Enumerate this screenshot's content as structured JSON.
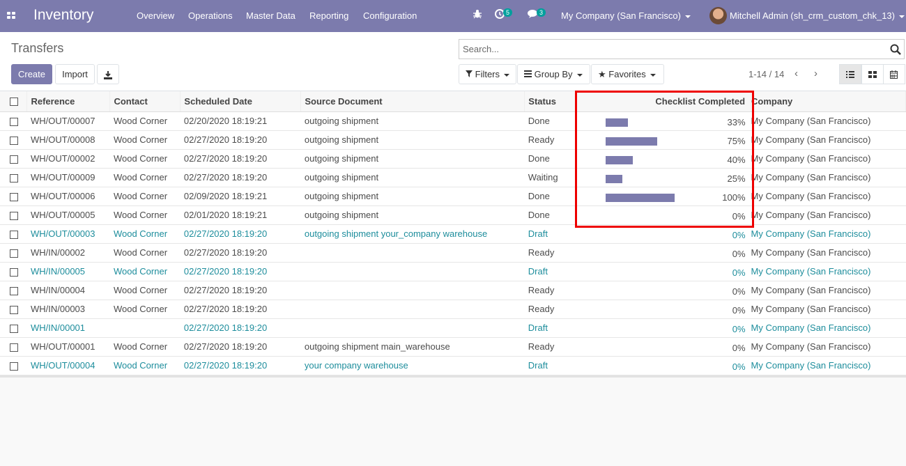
{
  "navbar": {
    "brand": "Inventory",
    "menus": [
      "Overview",
      "Operations",
      "Master Data",
      "Reporting",
      "Configuration"
    ],
    "activity_count": "5",
    "message_count": "3",
    "company": "My Company (San Francisco)",
    "user": "Mitchell Admin (sh_crm_custom_chk_13)"
  },
  "control": {
    "breadcrumb": "Transfers",
    "create_label": "Create",
    "import_label": "Import",
    "search_placeholder": "Search...",
    "filters_label": "Filters",
    "groupby_label": "Group By",
    "favorites_label": "Favorites",
    "pager": "1-14 / 14"
  },
  "table": {
    "headers": [
      "Reference",
      "Contact",
      "Scheduled Date",
      "Source Document",
      "Status",
      "Checklist Completed",
      "Company"
    ],
    "rows": [
      {
        "ref": "WH/OUT/00007",
        "contact": "Wood Corner",
        "date": "02/20/2020 18:19:21",
        "source": "outgoing shipment",
        "status": "Done",
        "progress": 33,
        "pct": "33%",
        "company": "My Company (San Francisco)",
        "draft": false
      },
      {
        "ref": "WH/OUT/00008",
        "contact": "Wood Corner",
        "date": "02/27/2020 18:19:20",
        "source": "outgoing shipment",
        "status": "Ready",
        "progress": 75,
        "pct": "75%",
        "company": "My Company (San Francisco)",
        "draft": false
      },
      {
        "ref": "WH/OUT/00002",
        "contact": "Wood Corner",
        "date": "02/27/2020 18:19:20",
        "source": "outgoing shipment",
        "status": "Done",
        "progress": 40,
        "pct": "40%",
        "company": "My Company (San Francisco)",
        "draft": false
      },
      {
        "ref": "WH/OUT/00009",
        "contact": "Wood Corner",
        "date": "02/27/2020 18:19:20",
        "source": "outgoing shipment",
        "status": "Waiting",
        "progress": 25,
        "pct": "25%",
        "company": "My Company (San Francisco)",
        "draft": false
      },
      {
        "ref": "WH/OUT/00006",
        "contact": "Wood Corner",
        "date": "02/09/2020 18:19:21",
        "source": "outgoing shipment",
        "status": "Done",
        "progress": 100,
        "pct": "100%",
        "company": "My Company (San Francisco)",
        "draft": false
      },
      {
        "ref": "WH/OUT/00005",
        "contact": "Wood Corner",
        "date": "02/01/2020 18:19:21",
        "source": "outgoing shipment",
        "status": "Done",
        "progress": 0,
        "pct": "0%",
        "company": "My Company (San Francisco)",
        "draft": false
      },
      {
        "ref": "WH/OUT/00003",
        "contact": "Wood Corner",
        "date": "02/27/2020 18:19:20",
        "source": "outgoing shipment your_company warehouse",
        "status": "Draft",
        "progress": 0,
        "pct": "0%",
        "company": "My Company (San Francisco)",
        "draft": true
      },
      {
        "ref": "WH/IN/00002",
        "contact": "Wood Corner",
        "date": "02/27/2020 18:19:20",
        "source": "",
        "status": "Ready",
        "progress": 0,
        "pct": "0%",
        "company": "My Company (San Francisco)",
        "draft": false
      },
      {
        "ref": "WH/IN/00005",
        "contact": "Wood Corner",
        "date": "02/27/2020 18:19:20",
        "source": "",
        "status": "Draft",
        "progress": 0,
        "pct": "0%",
        "company": "My Company (San Francisco)",
        "draft": true
      },
      {
        "ref": "WH/IN/00004",
        "contact": "Wood Corner",
        "date": "02/27/2020 18:19:20",
        "source": "",
        "status": "Ready",
        "progress": 0,
        "pct": "0%",
        "company": "My Company (San Francisco)",
        "draft": false
      },
      {
        "ref": "WH/IN/00003",
        "contact": "Wood Corner",
        "date": "02/27/2020 18:19:20",
        "source": "",
        "status": "Ready",
        "progress": 0,
        "pct": "0%",
        "company": "My Company (San Francisco)",
        "draft": false
      },
      {
        "ref": "WH/IN/00001",
        "contact": "",
        "date": "02/27/2020 18:19:20",
        "source": "",
        "status": "Draft",
        "progress": 0,
        "pct": "0%",
        "company": "My Company (San Francisco)",
        "draft": true
      },
      {
        "ref": "WH/OUT/00001",
        "contact": "Wood Corner",
        "date": "02/27/2020 18:19:20",
        "source": "outgoing shipment main_warehouse",
        "status": "Ready",
        "progress": 0,
        "pct": "0%",
        "company": "My Company (San Francisco)",
        "draft": false
      },
      {
        "ref": "WH/OUT/00004",
        "contact": "Wood Corner",
        "date": "02/27/2020 18:19:20",
        "source": "your company warehouse",
        "status": "Draft",
        "progress": 0,
        "pct": "0%",
        "company": "My Company (San Francisco)",
        "draft": true
      }
    ]
  },
  "colors": {
    "brand": "#7c7bad",
    "draft_link": "#1d8d9c",
    "highlight": "#e00000"
  }
}
